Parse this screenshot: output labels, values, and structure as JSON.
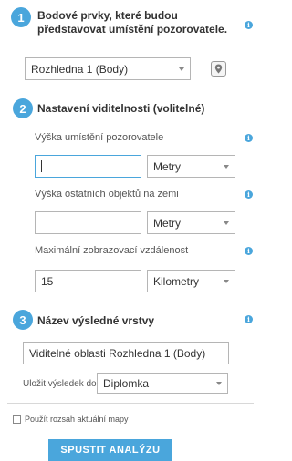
{
  "section1": {
    "number": "1",
    "title_line1": "Bodové prvky, které budou",
    "title_line2": "představovat umístění pozorovatele.",
    "layer_select": "Rozhledna 1 (Body)"
  },
  "section2": {
    "number": "2",
    "title": "Nastavení viditelnosti (volitelné)",
    "observer_height_label": "Výška umístění pozorovatele",
    "observer_height_value": "",
    "observer_height_unit": "Metry",
    "object_height_label": "Výška ostatních objektů na zemi",
    "object_height_value": "",
    "object_height_unit": "Metry",
    "max_distance_label": "Maximální zobrazovací vzdálenost",
    "max_distance_value": "15",
    "max_distance_unit": "Kilometry"
  },
  "section3": {
    "number": "3",
    "title": "Název výsledné vrstvy",
    "layer_name_value": "Viditelné oblasti Rozhledna 1 (Body)",
    "save_label": "Uložit výsledek do",
    "save_folder": "Diplomka"
  },
  "extent": {
    "label": "Použít rozsah aktuální mapy",
    "checked": false
  },
  "run_button": "SPUSTIT ANALÝZU",
  "icons": {
    "info": "i",
    "map_pin": "map-pin"
  },
  "colors": {
    "accent": "#4aa6dc"
  }
}
